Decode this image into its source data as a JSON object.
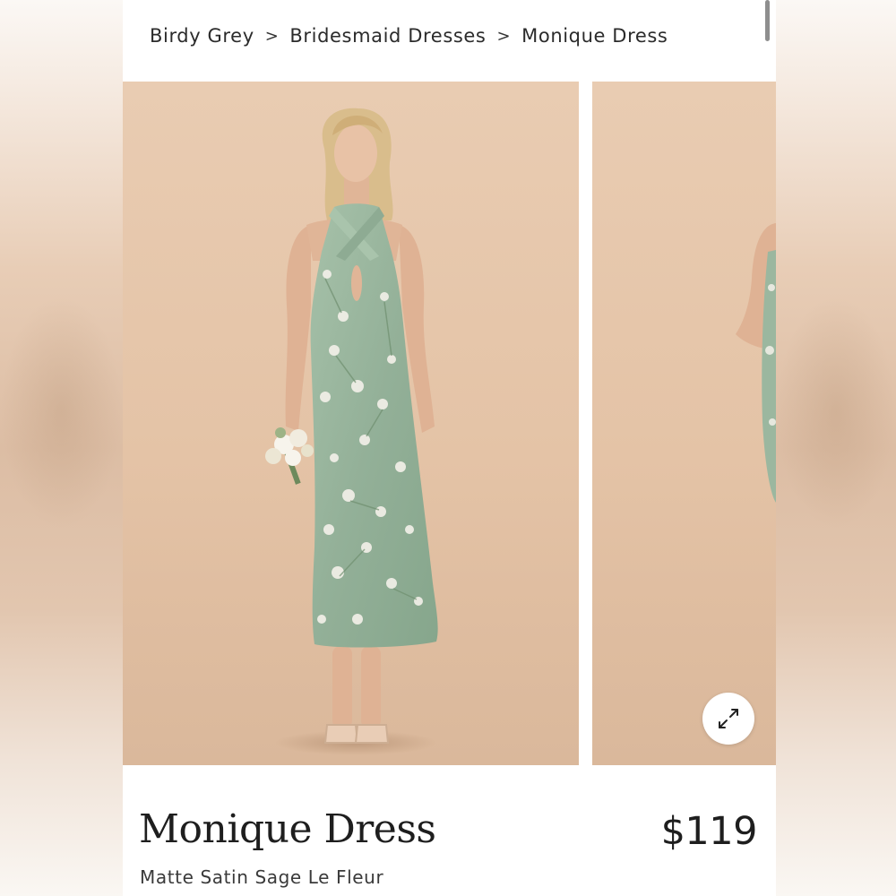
{
  "breadcrumb": {
    "items": [
      {
        "label": "Birdy Grey"
      },
      {
        "label": "Bridesmaid Dresses"
      },
      {
        "label": "Monique Dress"
      }
    ],
    "separator": ">"
  },
  "gallery": {
    "images": [
      {
        "alt": "Monique Dress front view"
      },
      {
        "alt": "Monique Dress side view"
      }
    ],
    "expand_icon": "expand-arrows-icon"
  },
  "product": {
    "name": "Monique Dress",
    "variant": "Matte Satin Sage Le Fleur",
    "price": "$119"
  },
  "colors": {
    "backdrop": "#e5c6aa",
    "dress": "#9bb79f",
    "text": "#1e1e1e"
  }
}
